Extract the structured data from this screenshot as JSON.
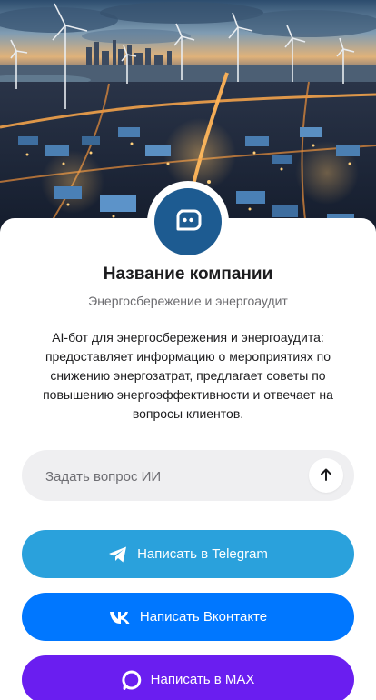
{
  "company": {
    "name": "Название компании",
    "subtitle": "Энергосбережение и энергоаудит",
    "description": "AI-бот для энергосбережения и энергоаудита: предоставляет информацию о мероприятиях по снижению энергозатрат, предлагает советы по повышению энергоэффективности и отвечает на вопросы клиентов."
  },
  "ask": {
    "placeholder": "Задать вопрос ИИ"
  },
  "buttons": {
    "telegram": "Написать в Telegram",
    "vk": "Написать Вконтакте",
    "max": "Написать в MAX"
  },
  "colors": {
    "telegram": "#2aa1dc",
    "vk": "#0077ff",
    "max": "#6a1ef0",
    "avatar": "#1d5b91"
  },
  "icons": {
    "avatar": "chat-bot-icon",
    "send": "arrow-up-icon",
    "telegram": "telegram-icon",
    "vk": "vk-icon",
    "max": "max-icon"
  }
}
